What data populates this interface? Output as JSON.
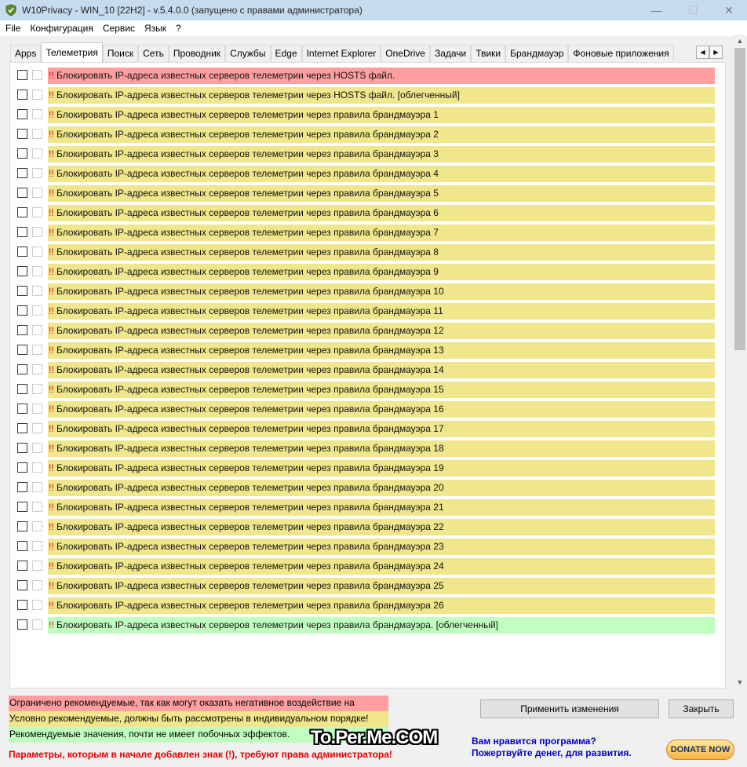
{
  "window": {
    "title": "W10Privacy - WIN_10 [22H2]  - v.5.4.0.0 (запущено с правами администратора)",
    "minimize": "—",
    "maximize": "☐",
    "close": "✕"
  },
  "menu": [
    "File",
    "Конфигурация",
    "Сервис",
    "Язык",
    "?"
  ],
  "tabs": [
    "Apps",
    "Телеметрия",
    "Поиск",
    "Сеть",
    "Проводник",
    "Службы",
    "Edge",
    "Internet Explorer",
    "OneDrive",
    "Задачи",
    "Твики",
    "Брандмауэр",
    "Фоновые приложения"
  ],
  "active_tab": 1,
  "tab_nav": {
    "left": "◀",
    "right": "▶"
  },
  "colors": {
    "red": "#ff9f9f",
    "yellow": "#f0e68c",
    "green": "#c0ffc0"
  },
  "settings": [
    {
      "prefix": "!!",
      "text": " Блокировать IP-адреса известных серверов телеметрии через HOSTS файл.",
      "level": "red"
    },
    {
      "prefix": "!!",
      "text": " Блокировать IP-адреса известных серверов телеметрии через HOSTS файл. [облегченный]",
      "level": "yellow"
    },
    {
      "prefix": "!!",
      "text": " Блокировать IP-адреса известных серверов телеметрии через правила брандмауэра 1",
      "level": "yellow"
    },
    {
      "prefix": "!!",
      "text": " Блокировать IP-адреса известных серверов телеметрии через правила брандмауэра 2",
      "level": "yellow"
    },
    {
      "prefix": "!!",
      "text": " Блокировать IP-адреса известных серверов телеметрии через правила брандмауэра 3",
      "level": "yellow"
    },
    {
      "prefix": "!!",
      "text": " Блокировать IP-адреса известных серверов телеметрии через правила брандмауэра 4",
      "level": "yellow"
    },
    {
      "prefix": "!!",
      "text": " Блокировать IP-адреса известных серверов телеметрии через правила брандмауэра 5",
      "level": "yellow"
    },
    {
      "prefix": "!!",
      "text": " Блокировать IP-адреса известных серверов телеметрии через правила брандмауэра 6",
      "level": "yellow"
    },
    {
      "prefix": "!!",
      "text": " Блокировать IP-адреса известных серверов телеметрии через правила брандмауэра 7",
      "level": "yellow"
    },
    {
      "prefix": "!!",
      "text": " Блокировать IP-адреса известных серверов телеметрии через правила брандмауэра 8",
      "level": "yellow"
    },
    {
      "prefix": "!!",
      "text": " Блокировать IP-адреса известных серверов телеметрии через правила брандмауэра 9",
      "level": "yellow"
    },
    {
      "prefix": "!!",
      "text": " Блокировать IP-адреса известных серверов телеметрии через правила брандмауэра 10",
      "level": "yellow"
    },
    {
      "prefix": "!!",
      "text": " Блокировать IP-адреса известных серверов телеметрии через правила брандмауэра 11",
      "level": "yellow"
    },
    {
      "prefix": "!!",
      "text": " Блокировать IP-адреса известных серверов телеметрии через правила брандмауэра 12",
      "level": "yellow"
    },
    {
      "prefix": "!!",
      "text": " Блокировать IP-адреса известных серверов телеметрии через правила брандмауэра 13",
      "level": "yellow"
    },
    {
      "prefix": "!!",
      "text": " Блокировать IP-адреса известных серверов телеметрии через правила брандмауэра 14",
      "level": "yellow"
    },
    {
      "prefix": "!!",
      "text": " Блокировать IP-адреса известных серверов телеметрии через правила брандмауэра 15",
      "level": "yellow"
    },
    {
      "prefix": "!!",
      "text": " Блокировать IP-адреса известных серверов телеметрии через правила брандмауэра 16",
      "level": "yellow"
    },
    {
      "prefix": "!!",
      "text": " Блокировать IP-адреса известных серверов телеметрии через правила брандмауэра 17",
      "level": "yellow"
    },
    {
      "prefix": "!!",
      "text": " Блокировать IP-адреса известных серверов телеметрии через правила брандмауэра 18",
      "level": "yellow"
    },
    {
      "prefix": "!!",
      "text": " Блокировать IP-адреса известных серверов телеметрии через правила брандмауэра 19",
      "level": "yellow"
    },
    {
      "prefix": "!!",
      "text": " Блокировать IP-адреса известных серверов телеметрии через правила брандмауэра 20",
      "level": "yellow"
    },
    {
      "prefix": "!!",
      "text": " Блокировать IP-адреса известных серверов телеметрии через правила брандмауэра 21",
      "level": "yellow"
    },
    {
      "prefix": "!!",
      "text": " Блокировать IP-адреса известных серверов телеметрии через правила брандмауэра 22",
      "level": "yellow"
    },
    {
      "prefix": "!!",
      "text": " Блокировать IP-адреса известных серверов телеметрии через правила брандмауэра 23",
      "level": "yellow"
    },
    {
      "prefix": "!!",
      "text": " Блокировать IP-адреса известных серверов телеметрии через правила брандмауэра 24",
      "level": "yellow"
    },
    {
      "prefix": "!!",
      "text": " Блокировать IP-адреса известных серверов телеметрии через правила брандмауэра 25",
      "level": "yellow"
    },
    {
      "prefix": "!!",
      "text": " Блокировать IP-адреса известных серверов телеметрии через правила брандмауэра 26",
      "level": "yellow"
    },
    {
      "prefix": "!!",
      "text": " Блокировать IP-адреса известных серверов телеметрии через правила брандмауэра.  [облегченный]",
      "level": "green"
    }
  ],
  "legend": {
    "red": "Ограничено рекомендуемые, так как могут оказать негативное воздействие на",
    "yellow": "Условно рекомендуемые, должны быть рассмотрены в индивидуальном порядке!",
    "green": "Рекомендуемые значения, почти не имеет побочных эффектов."
  },
  "admin_note": "Параметры, которым в начале добавлен знак (!), требуют права администратора!",
  "buttons": {
    "apply": "Применить изменения",
    "close": "Закрыть"
  },
  "donate": {
    "line1": "Вам нравится программа?",
    "line2": "Пожертвуйте денег, для развития.",
    "button": "DONATE NOW"
  },
  "watermark": "To.Per.Me.COM",
  "scrollbar": {
    "up": "▲",
    "down": "▼"
  }
}
